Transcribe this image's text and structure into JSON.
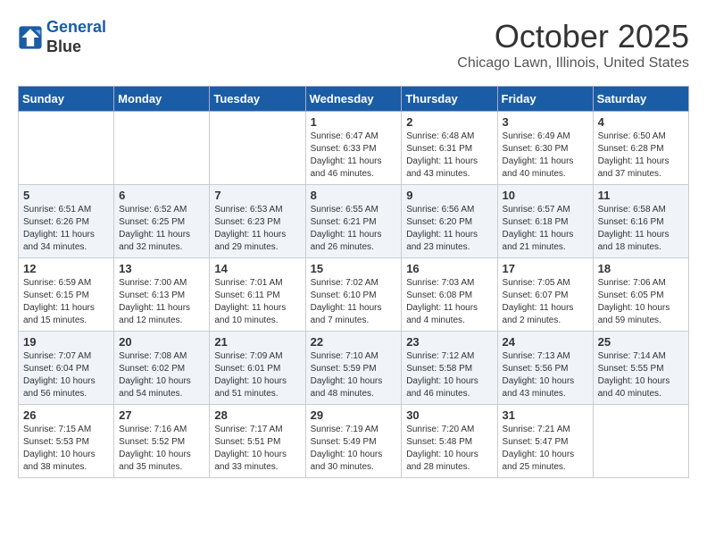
{
  "logo": {
    "line1": "General",
    "line2": "Blue"
  },
  "title": "October 2025",
  "subtitle": "Chicago Lawn, Illinois, United States",
  "weekdays": [
    "Sunday",
    "Monday",
    "Tuesday",
    "Wednesday",
    "Thursday",
    "Friday",
    "Saturday"
  ],
  "weeks": [
    [
      {
        "day": "",
        "info": ""
      },
      {
        "day": "",
        "info": ""
      },
      {
        "day": "",
        "info": ""
      },
      {
        "day": "1",
        "info": "Sunrise: 6:47 AM\nSunset: 6:33 PM\nDaylight: 11 hours\nand 46 minutes."
      },
      {
        "day": "2",
        "info": "Sunrise: 6:48 AM\nSunset: 6:31 PM\nDaylight: 11 hours\nand 43 minutes."
      },
      {
        "day": "3",
        "info": "Sunrise: 6:49 AM\nSunset: 6:30 PM\nDaylight: 11 hours\nand 40 minutes."
      },
      {
        "day": "4",
        "info": "Sunrise: 6:50 AM\nSunset: 6:28 PM\nDaylight: 11 hours\nand 37 minutes."
      }
    ],
    [
      {
        "day": "5",
        "info": "Sunrise: 6:51 AM\nSunset: 6:26 PM\nDaylight: 11 hours\nand 34 minutes."
      },
      {
        "day": "6",
        "info": "Sunrise: 6:52 AM\nSunset: 6:25 PM\nDaylight: 11 hours\nand 32 minutes."
      },
      {
        "day": "7",
        "info": "Sunrise: 6:53 AM\nSunset: 6:23 PM\nDaylight: 11 hours\nand 29 minutes."
      },
      {
        "day": "8",
        "info": "Sunrise: 6:55 AM\nSunset: 6:21 PM\nDaylight: 11 hours\nand 26 minutes."
      },
      {
        "day": "9",
        "info": "Sunrise: 6:56 AM\nSunset: 6:20 PM\nDaylight: 11 hours\nand 23 minutes."
      },
      {
        "day": "10",
        "info": "Sunrise: 6:57 AM\nSunset: 6:18 PM\nDaylight: 11 hours\nand 21 minutes."
      },
      {
        "day": "11",
        "info": "Sunrise: 6:58 AM\nSunset: 6:16 PM\nDaylight: 11 hours\nand 18 minutes."
      }
    ],
    [
      {
        "day": "12",
        "info": "Sunrise: 6:59 AM\nSunset: 6:15 PM\nDaylight: 11 hours\nand 15 minutes."
      },
      {
        "day": "13",
        "info": "Sunrise: 7:00 AM\nSunset: 6:13 PM\nDaylight: 11 hours\nand 12 minutes."
      },
      {
        "day": "14",
        "info": "Sunrise: 7:01 AM\nSunset: 6:11 PM\nDaylight: 11 hours\nand 10 minutes."
      },
      {
        "day": "15",
        "info": "Sunrise: 7:02 AM\nSunset: 6:10 PM\nDaylight: 11 hours\nand 7 minutes."
      },
      {
        "day": "16",
        "info": "Sunrise: 7:03 AM\nSunset: 6:08 PM\nDaylight: 11 hours\nand 4 minutes."
      },
      {
        "day": "17",
        "info": "Sunrise: 7:05 AM\nSunset: 6:07 PM\nDaylight: 11 hours\nand 2 minutes."
      },
      {
        "day": "18",
        "info": "Sunrise: 7:06 AM\nSunset: 6:05 PM\nDaylight: 10 hours\nand 59 minutes."
      }
    ],
    [
      {
        "day": "19",
        "info": "Sunrise: 7:07 AM\nSunset: 6:04 PM\nDaylight: 10 hours\nand 56 minutes."
      },
      {
        "day": "20",
        "info": "Sunrise: 7:08 AM\nSunset: 6:02 PM\nDaylight: 10 hours\nand 54 minutes."
      },
      {
        "day": "21",
        "info": "Sunrise: 7:09 AM\nSunset: 6:01 PM\nDaylight: 10 hours\nand 51 minutes."
      },
      {
        "day": "22",
        "info": "Sunrise: 7:10 AM\nSunset: 5:59 PM\nDaylight: 10 hours\nand 48 minutes."
      },
      {
        "day": "23",
        "info": "Sunrise: 7:12 AM\nSunset: 5:58 PM\nDaylight: 10 hours\nand 46 minutes."
      },
      {
        "day": "24",
        "info": "Sunrise: 7:13 AM\nSunset: 5:56 PM\nDaylight: 10 hours\nand 43 minutes."
      },
      {
        "day": "25",
        "info": "Sunrise: 7:14 AM\nSunset: 5:55 PM\nDaylight: 10 hours\nand 40 minutes."
      }
    ],
    [
      {
        "day": "26",
        "info": "Sunrise: 7:15 AM\nSunset: 5:53 PM\nDaylight: 10 hours\nand 38 minutes."
      },
      {
        "day": "27",
        "info": "Sunrise: 7:16 AM\nSunset: 5:52 PM\nDaylight: 10 hours\nand 35 minutes."
      },
      {
        "day": "28",
        "info": "Sunrise: 7:17 AM\nSunset: 5:51 PM\nDaylight: 10 hours\nand 33 minutes."
      },
      {
        "day": "29",
        "info": "Sunrise: 7:19 AM\nSunset: 5:49 PM\nDaylight: 10 hours\nand 30 minutes."
      },
      {
        "day": "30",
        "info": "Sunrise: 7:20 AM\nSunset: 5:48 PM\nDaylight: 10 hours\nand 28 minutes."
      },
      {
        "day": "31",
        "info": "Sunrise: 7:21 AM\nSunset: 5:47 PM\nDaylight: 10 hours\nand 25 minutes."
      },
      {
        "day": "",
        "info": ""
      }
    ]
  ]
}
